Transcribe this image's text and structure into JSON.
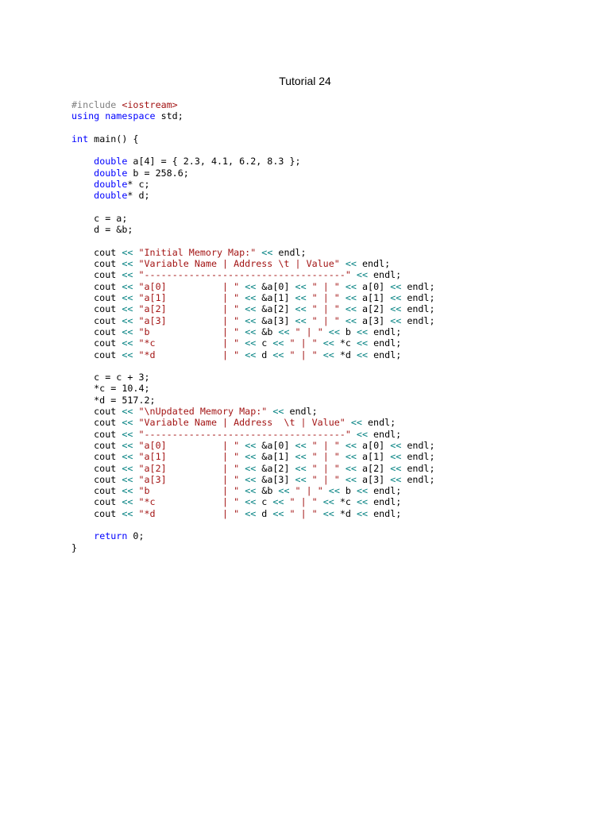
{
  "document": {
    "title": "Tutorial 24"
  },
  "colors": {
    "keyword": "#0000ff",
    "string": "#a31515",
    "operator": "#008080",
    "preprocessor": "#808080",
    "text": "#000000"
  },
  "code": {
    "lines": [
      [
        {
          "t": "prep",
          "v": "#include "
        },
        {
          "t": "inc",
          "v": "<iostream>"
        }
      ],
      [
        {
          "t": "kw",
          "v": "using namespace"
        },
        {
          "t": "plain",
          "v": " std;"
        }
      ],
      [],
      [
        {
          "t": "kw",
          "v": "int"
        },
        {
          "t": "plain",
          "v": " main() {"
        }
      ],
      [],
      [
        {
          "t": "plain",
          "v": "    "
        },
        {
          "t": "kw",
          "v": "double"
        },
        {
          "t": "plain",
          "v": " a[4] = { 2.3, 4.1, 6.2, 8.3 };"
        }
      ],
      [
        {
          "t": "plain",
          "v": "    "
        },
        {
          "t": "kw",
          "v": "double"
        },
        {
          "t": "plain",
          "v": " b = 258.6;"
        }
      ],
      [
        {
          "t": "plain",
          "v": "    "
        },
        {
          "t": "kw",
          "v": "double"
        },
        {
          "t": "plain",
          "v": "* c;"
        }
      ],
      [
        {
          "t": "plain",
          "v": "    "
        },
        {
          "t": "kw",
          "v": "double"
        },
        {
          "t": "plain",
          "v": "* d;"
        }
      ],
      [],
      [
        {
          "t": "plain",
          "v": "    c = a;"
        }
      ],
      [
        {
          "t": "plain",
          "v": "    d = &b;"
        }
      ],
      [],
      [
        {
          "t": "plain",
          "v": "    cout "
        },
        {
          "t": "op",
          "v": "<<"
        },
        {
          "t": "plain",
          "v": " "
        },
        {
          "t": "str",
          "v": "\"Initial Memory Map:\""
        },
        {
          "t": "plain",
          "v": " "
        },
        {
          "t": "op",
          "v": "<<"
        },
        {
          "t": "plain",
          "v": " endl;"
        }
      ],
      [
        {
          "t": "plain",
          "v": "    cout "
        },
        {
          "t": "op",
          "v": "<<"
        },
        {
          "t": "plain",
          "v": " "
        },
        {
          "t": "str",
          "v": "\"Variable Name | Address \\t | Value\""
        },
        {
          "t": "plain",
          "v": " "
        },
        {
          "t": "op",
          "v": "<<"
        },
        {
          "t": "plain",
          "v": " endl;"
        }
      ],
      [
        {
          "t": "plain",
          "v": "    cout "
        },
        {
          "t": "op",
          "v": "<<"
        },
        {
          "t": "plain",
          "v": " "
        },
        {
          "t": "str",
          "v": "\"------------------------------------\""
        },
        {
          "t": "plain",
          "v": " "
        },
        {
          "t": "op",
          "v": "<<"
        },
        {
          "t": "plain",
          "v": " endl;"
        }
      ],
      [
        {
          "t": "plain",
          "v": "    cout "
        },
        {
          "t": "op",
          "v": "<<"
        },
        {
          "t": "plain",
          "v": " "
        },
        {
          "t": "str",
          "v": "\"a[0]          | \""
        },
        {
          "t": "plain",
          "v": " "
        },
        {
          "t": "op",
          "v": "<<"
        },
        {
          "t": "plain",
          "v": " &a[0] "
        },
        {
          "t": "op",
          "v": "<<"
        },
        {
          "t": "plain",
          "v": " "
        },
        {
          "t": "str",
          "v": "\" | \""
        },
        {
          "t": "plain",
          "v": " "
        },
        {
          "t": "op",
          "v": "<<"
        },
        {
          "t": "plain",
          "v": " a[0] "
        },
        {
          "t": "op",
          "v": "<<"
        },
        {
          "t": "plain",
          "v": " endl;"
        }
      ],
      [
        {
          "t": "plain",
          "v": "    cout "
        },
        {
          "t": "op",
          "v": "<<"
        },
        {
          "t": "plain",
          "v": " "
        },
        {
          "t": "str",
          "v": "\"a[1]          | \""
        },
        {
          "t": "plain",
          "v": " "
        },
        {
          "t": "op",
          "v": "<<"
        },
        {
          "t": "plain",
          "v": " &a[1] "
        },
        {
          "t": "op",
          "v": "<<"
        },
        {
          "t": "plain",
          "v": " "
        },
        {
          "t": "str",
          "v": "\" | \""
        },
        {
          "t": "plain",
          "v": " "
        },
        {
          "t": "op",
          "v": "<<"
        },
        {
          "t": "plain",
          "v": " a[1] "
        },
        {
          "t": "op",
          "v": "<<"
        },
        {
          "t": "plain",
          "v": " endl;"
        }
      ],
      [
        {
          "t": "plain",
          "v": "    cout "
        },
        {
          "t": "op",
          "v": "<<"
        },
        {
          "t": "plain",
          "v": " "
        },
        {
          "t": "str",
          "v": "\"a[2]          | \""
        },
        {
          "t": "plain",
          "v": " "
        },
        {
          "t": "op",
          "v": "<<"
        },
        {
          "t": "plain",
          "v": " &a[2] "
        },
        {
          "t": "op",
          "v": "<<"
        },
        {
          "t": "plain",
          "v": " "
        },
        {
          "t": "str",
          "v": "\" | \""
        },
        {
          "t": "plain",
          "v": " "
        },
        {
          "t": "op",
          "v": "<<"
        },
        {
          "t": "plain",
          "v": " a[2] "
        },
        {
          "t": "op",
          "v": "<<"
        },
        {
          "t": "plain",
          "v": " endl;"
        }
      ],
      [
        {
          "t": "plain",
          "v": "    cout "
        },
        {
          "t": "op",
          "v": "<<"
        },
        {
          "t": "plain",
          "v": " "
        },
        {
          "t": "str",
          "v": "\"a[3]          | \""
        },
        {
          "t": "plain",
          "v": " "
        },
        {
          "t": "op",
          "v": "<<"
        },
        {
          "t": "plain",
          "v": " &a[3] "
        },
        {
          "t": "op",
          "v": "<<"
        },
        {
          "t": "plain",
          "v": " "
        },
        {
          "t": "str",
          "v": "\" | \""
        },
        {
          "t": "plain",
          "v": " "
        },
        {
          "t": "op",
          "v": "<<"
        },
        {
          "t": "plain",
          "v": " a[3] "
        },
        {
          "t": "op",
          "v": "<<"
        },
        {
          "t": "plain",
          "v": " endl;"
        }
      ],
      [
        {
          "t": "plain",
          "v": "    cout "
        },
        {
          "t": "op",
          "v": "<<"
        },
        {
          "t": "plain",
          "v": " "
        },
        {
          "t": "str",
          "v": "\"b             | \""
        },
        {
          "t": "plain",
          "v": " "
        },
        {
          "t": "op",
          "v": "<<"
        },
        {
          "t": "plain",
          "v": " &b "
        },
        {
          "t": "op",
          "v": "<<"
        },
        {
          "t": "plain",
          "v": " "
        },
        {
          "t": "str",
          "v": "\" | \""
        },
        {
          "t": "plain",
          "v": " "
        },
        {
          "t": "op",
          "v": "<<"
        },
        {
          "t": "plain",
          "v": " b "
        },
        {
          "t": "op",
          "v": "<<"
        },
        {
          "t": "plain",
          "v": " endl;"
        }
      ],
      [
        {
          "t": "plain",
          "v": "    cout "
        },
        {
          "t": "op",
          "v": "<<"
        },
        {
          "t": "plain",
          "v": " "
        },
        {
          "t": "str",
          "v": "\"*c            | \""
        },
        {
          "t": "plain",
          "v": " "
        },
        {
          "t": "op",
          "v": "<<"
        },
        {
          "t": "plain",
          "v": " c "
        },
        {
          "t": "op",
          "v": "<<"
        },
        {
          "t": "plain",
          "v": " "
        },
        {
          "t": "str",
          "v": "\" | \""
        },
        {
          "t": "plain",
          "v": " "
        },
        {
          "t": "op",
          "v": "<<"
        },
        {
          "t": "plain",
          "v": " *c "
        },
        {
          "t": "op",
          "v": "<<"
        },
        {
          "t": "plain",
          "v": " endl;"
        }
      ],
      [
        {
          "t": "plain",
          "v": "    cout "
        },
        {
          "t": "op",
          "v": "<<"
        },
        {
          "t": "plain",
          "v": " "
        },
        {
          "t": "str",
          "v": "\"*d            | \""
        },
        {
          "t": "plain",
          "v": " "
        },
        {
          "t": "op",
          "v": "<<"
        },
        {
          "t": "plain",
          "v": " d "
        },
        {
          "t": "op",
          "v": "<<"
        },
        {
          "t": "plain",
          "v": " "
        },
        {
          "t": "str",
          "v": "\" | \""
        },
        {
          "t": "plain",
          "v": " "
        },
        {
          "t": "op",
          "v": "<<"
        },
        {
          "t": "plain",
          "v": " *d "
        },
        {
          "t": "op",
          "v": "<<"
        },
        {
          "t": "plain",
          "v": " endl;"
        }
      ],
      [],
      [
        {
          "t": "plain",
          "v": "    c = c + 3;"
        }
      ],
      [
        {
          "t": "plain",
          "v": "    *c = 10.4;"
        }
      ],
      [
        {
          "t": "plain",
          "v": "    *d = 517.2;"
        }
      ],
      [
        {
          "t": "plain",
          "v": "    cout "
        },
        {
          "t": "op",
          "v": "<<"
        },
        {
          "t": "plain",
          "v": " "
        },
        {
          "t": "str",
          "v": "\"\\nUpdated Memory Map:\""
        },
        {
          "t": "plain",
          "v": " "
        },
        {
          "t": "op",
          "v": "<<"
        },
        {
          "t": "plain",
          "v": " endl;"
        }
      ],
      [
        {
          "t": "plain",
          "v": "    cout "
        },
        {
          "t": "op",
          "v": "<<"
        },
        {
          "t": "plain",
          "v": " "
        },
        {
          "t": "str",
          "v": "\"Variable Name | Address  \\t | Value\""
        },
        {
          "t": "plain",
          "v": " "
        },
        {
          "t": "op",
          "v": "<<"
        },
        {
          "t": "plain",
          "v": " endl;"
        }
      ],
      [
        {
          "t": "plain",
          "v": "    cout "
        },
        {
          "t": "op",
          "v": "<<"
        },
        {
          "t": "plain",
          "v": " "
        },
        {
          "t": "str",
          "v": "\"------------------------------------\""
        },
        {
          "t": "plain",
          "v": " "
        },
        {
          "t": "op",
          "v": "<<"
        },
        {
          "t": "plain",
          "v": " endl;"
        }
      ],
      [
        {
          "t": "plain",
          "v": "    cout "
        },
        {
          "t": "op",
          "v": "<<"
        },
        {
          "t": "plain",
          "v": " "
        },
        {
          "t": "str",
          "v": "\"a[0]          | \""
        },
        {
          "t": "plain",
          "v": " "
        },
        {
          "t": "op",
          "v": "<<"
        },
        {
          "t": "plain",
          "v": " &a[0] "
        },
        {
          "t": "op",
          "v": "<<"
        },
        {
          "t": "plain",
          "v": " "
        },
        {
          "t": "str",
          "v": "\" | \""
        },
        {
          "t": "plain",
          "v": " "
        },
        {
          "t": "op",
          "v": "<<"
        },
        {
          "t": "plain",
          "v": " a[0] "
        },
        {
          "t": "op",
          "v": "<<"
        },
        {
          "t": "plain",
          "v": " endl;"
        }
      ],
      [
        {
          "t": "plain",
          "v": "    cout "
        },
        {
          "t": "op",
          "v": "<<"
        },
        {
          "t": "plain",
          "v": " "
        },
        {
          "t": "str",
          "v": "\"a[1]          | \""
        },
        {
          "t": "plain",
          "v": " "
        },
        {
          "t": "op",
          "v": "<<"
        },
        {
          "t": "plain",
          "v": " &a[1] "
        },
        {
          "t": "op",
          "v": "<<"
        },
        {
          "t": "plain",
          "v": " "
        },
        {
          "t": "str",
          "v": "\" | \""
        },
        {
          "t": "plain",
          "v": " "
        },
        {
          "t": "op",
          "v": "<<"
        },
        {
          "t": "plain",
          "v": " a[1] "
        },
        {
          "t": "op",
          "v": "<<"
        },
        {
          "t": "plain",
          "v": " endl;"
        }
      ],
      [
        {
          "t": "plain",
          "v": "    cout "
        },
        {
          "t": "op",
          "v": "<<"
        },
        {
          "t": "plain",
          "v": " "
        },
        {
          "t": "str",
          "v": "\"a[2]          | \""
        },
        {
          "t": "plain",
          "v": " "
        },
        {
          "t": "op",
          "v": "<<"
        },
        {
          "t": "plain",
          "v": " &a[2] "
        },
        {
          "t": "op",
          "v": "<<"
        },
        {
          "t": "plain",
          "v": " "
        },
        {
          "t": "str",
          "v": "\" | \""
        },
        {
          "t": "plain",
          "v": " "
        },
        {
          "t": "op",
          "v": "<<"
        },
        {
          "t": "plain",
          "v": " a[2] "
        },
        {
          "t": "op",
          "v": "<<"
        },
        {
          "t": "plain",
          "v": " endl;"
        }
      ],
      [
        {
          "t": "plain",
          "v": "    cout "
        },
        {
          "t": "op",
          "v": "<<"
        },
        {
          "t": "plain",
          "v": " "
        },
        {
          "t": "str",
          "v": "\"a[3]          | \""
        },
        {
          "t": "plain",
          "v": " "
        },
        {
          "t": "op",
          "v": "<<"
        },
        {
          "t": "plain",
          "v": " &a[3] "
        },
        {
          "t": "op",
          "v": "<<"
        },
        {
          "t": "plain",
          "v": " "
        },
        {
          "t": "str",
          "v": "\" | \""
        },
        {
          "t": "plain",
          "v": " "
        },
        {
          "t": "op",
          "v": "<<"
        },
        {
          "t": "plain",
          "v": " a[3] "
        },
        {
          "t": "op",
          "v": "<<"
        },
        {
          "t": "plain",
          "v": " endl;"
        }
      ],
      [
        {
          "t": "plain",
          "v": "    cout "
        },
        {
          "t": "op",
          "v": "<<"
        },
        {
          "t": "plain",
          "v": " "
        },
        {
          "t": "str",
          "v": "\"b             | \""
        },
        {
          "t": "plain",
          "v": " "
        },
        {
          "t": "op",
          "v": "<<"
        },
        {
          "t": "plain",
          "v": " &b "
        },
        {
          "t": "op",
          "v": "<<"
        },
        {
          "t": "plain",
          "v": " "
        },
        {
          "t": "str",
          "v": "\" | \""
        },
        {
          "t": "plain",
          "v": " "
        },
        {
          "t": "op",
          "v": "<<"
        },
        {
          "t": "plain",
          "v": " b "
        },
        {
          "t": "op",
          "v": "<<"
        },
        {
          "t": "plain",
          "v": " endl;"
        }
      ],
      [
        {
          "t": "plain",
          "v": "    cout "
        },
        {
          "t": "op",
          "v": "<<"
        },
        {
          "t": "plain",
          "v": " "
        },
        {
          "t": "str",
          "v": "\"*c            | \""
        },
        {
          "t": "plain",
          "v": " "
        },
        {
          "t": "op",
          "v": "<<"
        },
        {
          "t": "plain",
          "v": " c "
        },
        {
          "t": "op",
          "v": "<<"
        },
        {
          "t": "plain",
          "v": " "
        },
        {
          "t": "str",
          "v": "\" | \""
        },
        {
          "t": "plain",
          "v": " "
        },
        {
          "t": "op",
          "v": "<<"
        },
        {
          "t": "plain",
          "v": " *c "
        },
        {
          "t": "op",
          "v": "<<"
        },
        {
          "t": "plain",
          "v": " endl;"
        }
      ],
      [
        {
          "t": "plain",
          "v": "    cout "
        },
        {
          "t": "op",
          "v": "<<"
        },
        {
          "t": "plain",
          "v": " "
        },
        {
          "t": "str",
          "v": "\"*d            | \""
        },
        {
          "t": "plain",
          "v": " "
        },
        {
          "t": "op",
          "v": "<<"
        },
        {
          "t": "plain",
          "v": " d "
        },
        {
          "t": "op",
          "v": "<<"
        },
        {
          "t": "plain",
          "v": " "
        },
        {
          "t": "str",
          "v": "\" | \""
        },
        {
          "t": "plain",
          "v": " "
        },
        {
          "t": "op",
          "v": "<<"
        },
        {
          "t": "plain",
          "v": " *d "
        },
        {
          "t": "op",
          "v": "<<"
        },
        {
          "t": "plain",
          "v": " endl;"
        }
      ],
      [],
      [
        {
          "t": "plain",
          "v": "    "
        },
        {
          "t": "kw",
          "v": "return"
        },
        {
          "t": "plain",
          "v": " 0;"
        }
      ],
      [
        {
          "t": "plain",
          "v": "}"
        }
      ]
    ]
  }
}
